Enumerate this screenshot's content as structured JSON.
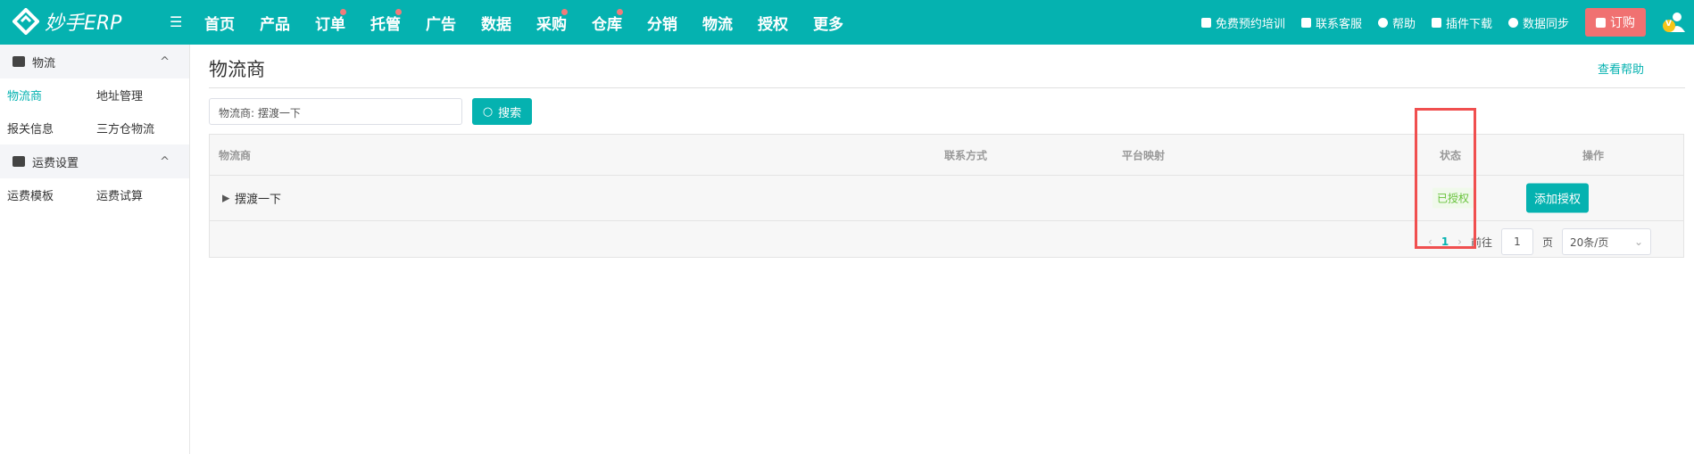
{
  "header": {
    "logo": "妙手ERP",
    "nav": [
      {
        "label": "首页",
        "dot": false
      },
      {
        "label": "产品",
        "dot": false
      },
      {
        "label": "订单",
        "dot": true
      },
      {
        "label": "托管",
        "dot": true
      },
      {
        "label": "广告",
        "dot": false
      },
      {
        "label": "数据",
        "dot": false
      },
      {
        "label": "采购",
        "dot": true
      },
      {
        "label": "仓库",
        "dot": true
      },
      {
        "label": "分销",
        "dot": false
      },
      {
        "label": "物流",
        "dot": false
      },
      {
        "label": "授权",
        "dot": false
      },
      {
        "label": "更多",
        "dot": false
      }
    ],
    "right": [
      "免费预约培训",
      "联系客服",
      "帮助",
      "插件下载",
      "数据同步"
    ],
    "buy": "订购",
    "avatar_badge": "V"
  },
  "sidebar": {
    "groups": [
      {
        "label": "物流",
        "items": [
          [
            "物流商",
            "地址管理"
          ],
          [
            "报关信息",
            "三方仓物流"
          ]
        ]
      },
      {
        "label": "运费设置",
        "items": [
          [
            "运费模板",
            "运费试算"
          ]
        ]
      }
    ]
  },
  "page": {
    "title": "物流商",
    "help": "查看帮助",
    "search_value": "物流商:  摆渡一下",
    "search_button": "搜索"
  },
  "table": {
    "headers": [
      "物流商",
      "联系方式",
      "平台映射",
      "状态",
      "操作"
    ],
    "rows": [
      {
        "name": "摆渡一下",
        "status": "已授权",
        "action": "添加授权"
      }
    ]
  },
  "pagination": {
    "current": "1",
    "goto_label": "前往",
    "goto_value": "1",
    "page_suffix": "页",
    "page_size": "20条/页"
  }
}
